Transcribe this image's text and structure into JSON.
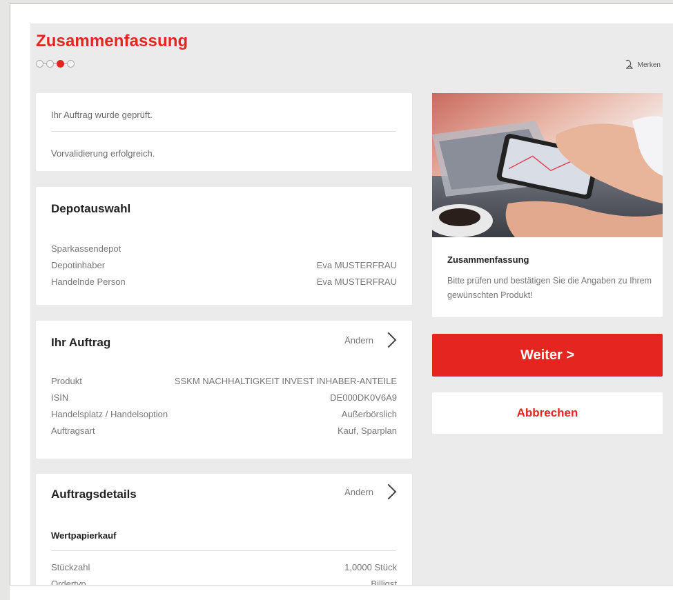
{
  "header": {
    "title": "Zusammenfassung",
    "steps_total": 4,
    "steps_active_index": 2,
    "bookmark_label": "Merken",
    "bookmark_icon": "bookmark-icon"
  },
  "status": {
    "line1": "Ihr Auftrag wurde geprüft.",
    "line2": "Vorvalidierung erfolgreich."
  },
  "depot": {
    "title": "Depotauswahl",
    "account": "Sparkassendepot",
    "rows": [
      {
        "label": "Depotinhaber",
        "value": "Eva MUSTERFRAU"
      },
      {
        "label": "Handelnde Person",
        "value": "Eva MUSTERFRAU"
      }
    ]
  },
  "order": {
    "title": "Ihr Auftrag",
    "change_label": "Ändern",
    "rows": [
      {
        "label": "Produkt",
        "value": "SSKM NACHHALTIGKEIT INVEST INHABER-ANTEILE"
      },
      {
        "label": "ISIN",
        "value": "DE000DK0V6A9"
      },
      {
        "label": "Handelsplatz / Handelsoption",
        "value": "Außerbörslich"
      },
      {
        "label": "Auftragsart",
        "value": "Kauf, Sparplan"
      }
    ]
  },
  "details": {
    "title": "Auftragsdetails",
    "change_label": "Ändern",
    "subtitle": "Wertpapierkauf",
    "rows": [
      {
        "label": "Stückzahl",
        "value": "1,0000 Stück"
      },
      {
        "label": "Ordertyp",
        "value": "Billigst"
      }
    ]
  },
  "promo": {
    "title": "Zusammenfassung",
    "text": "Bitte prüfen und bestätigen Sie die Angaben zu Ihrem gewünschten Produkt!"
  },
  "actions": {
    "primary_label": "Weiter >",
    "secondary_label": "Abbrechen"
  },
  "colors": {
    "accent": "#e52620",
    "background": "#ebebeb",
    "card": "#ffffff"
  }
}
